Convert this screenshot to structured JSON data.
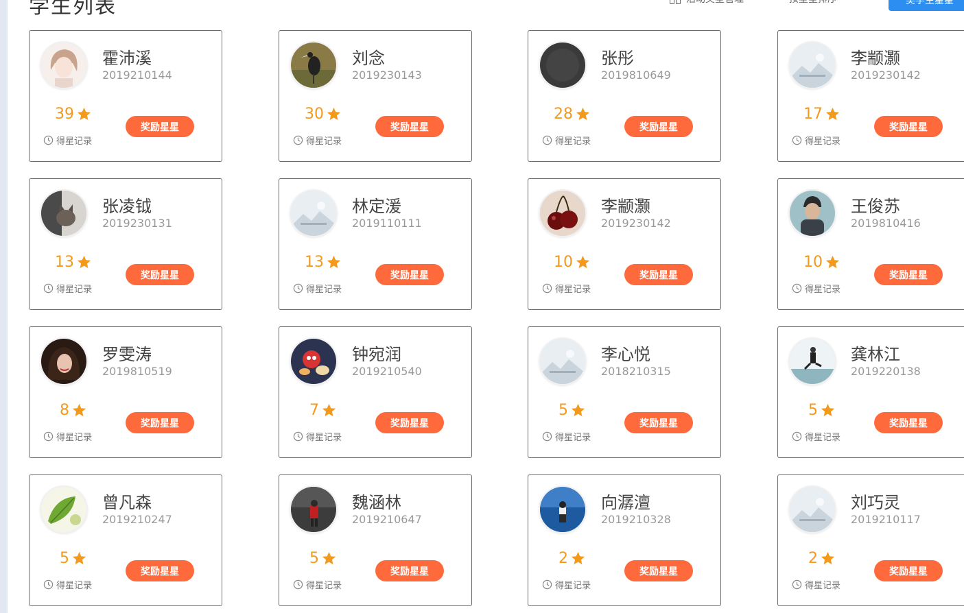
{
  "header": {
    "title": "学生列表",
    "activity_link": "活动奖星管理",
    "sort_link": "按星星排序",
    "add_button": "奖学生星星"
  },
  "colors": {
    "star": "#f39a1d",
    "reward_button": "#ff6a3d",
    "primary_button": "#2b8ef0",
    "card_border": "#6b6b6b"
  },
  "card_labels": {
    "reward_button": "奖励星星",
    "record_link": "得星记录"
  },
  "students": [
    {
      "name": "霍沛溪",
      "id": "2019210144",
      "stars": "39",
      "avatar": "anime-girl"
    },
    {
      "name": "刘念",
      "id": "2019230143",
      "stars": "30",
      "avatar": "bird"
    },
    {
      "name": "张彤",
      "id": "2019810649",
      "stars": "28",
      "avatar": "dark"
    },
    {
      "name": "李颛灏",
      "id": "2019230142",
      "stars": "17",
      "avatar": "placeholder"
    },
    {
      "name": "张凌钺",
      "id": "2019230131",
      "stars": "13",
      "avatar": "cat"
    },
    {
      "name": "林定湲",
      "id": "2019110111",
      "stars": "13",
      "avatar": "placeholder"
    },
    {
      "name": "李颛灏",
      "id": "2019230142",
      "stars": "10",
      "avatar": "cherries"
    },
    {
      "name": "王俊苏",
      "id": "2019810416",
      "stars": "10",
      "avatar": "man-beanie"
    },
    {
      "name": "罗雯涛",
      "id": "2019810519",
      "stars": "8",
      "avatar": "woman"
    },
    {
      "name": "钟宛润",
      "id": "2019210540",
      "stars": "7",
      "avatar": "cartoon"
    },
    {
      "name": "李心悦",
      "id": "2018210315",
      "stars": "5",
      "avatar": "placeholder"
    },
    {
      "name": "龚林江",
      "id": "2019220138",
      "stars": "5",
      "avatar": "jumper"
    },
    {
      "name": "曾凡森",
      "id": "2019210247",
      "stars": "5",
      "avatar": "leaf"
    },
    {
      "name": "魏涵林",
      "id": "2019210647",
      "stars": "5",
      "avatar": "person-red"
    },
    {
      "name": "向潺澶",
      "id": "2019210328",
      "stars": "2",
      "avatar": "sea"
    },
    {
      "name": "刘巧灵",
      "id": "2019210117",
      "stars": "2",
      "avatar": "placeholder"
    }
  ]
}
